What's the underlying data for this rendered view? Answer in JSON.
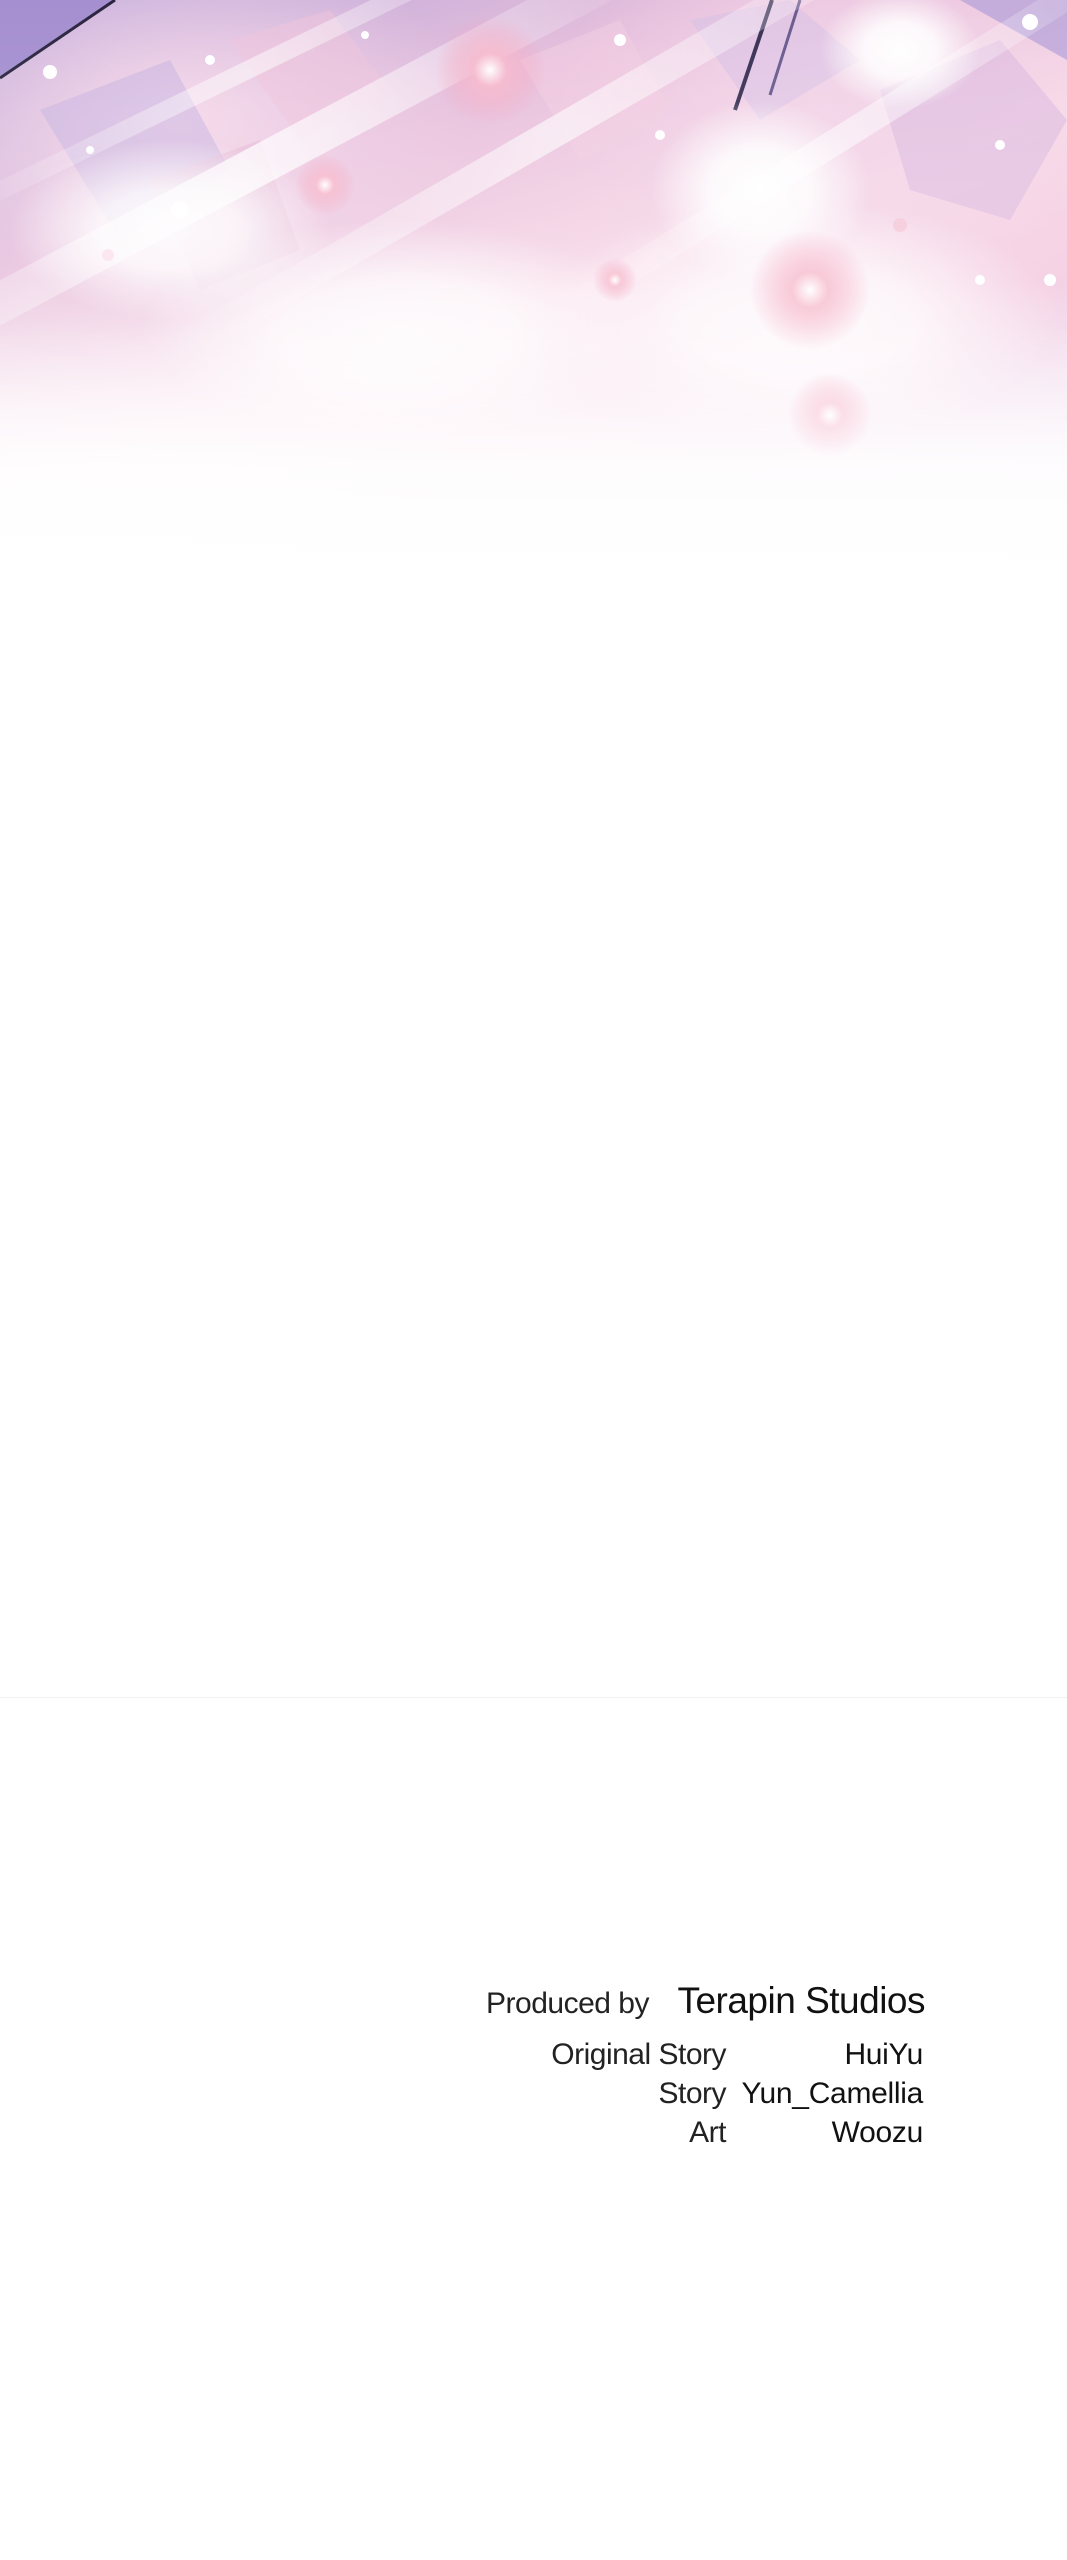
{
  "credits": {
    "produced_label": "Produced by",
    "studio": "Terapin Studios",
    "roles": [
      {
        "role": "Original Story",
        "name": "HuiYu"
      },
      {
        "role": "Story",
        "name": "Yun_Camellia"
      },
      {
        "role": "Art",
        "name": "Woozu"
      }
    ]
  },
  "colors": {
    "background": "#ffffff",
    "panel_lavender": "#b9a6d9",
    "panel_pink": "#f3c8df",
    "sparkle_red": "#e58aa6",
    "text": "#1a1a1a"
  }
}
